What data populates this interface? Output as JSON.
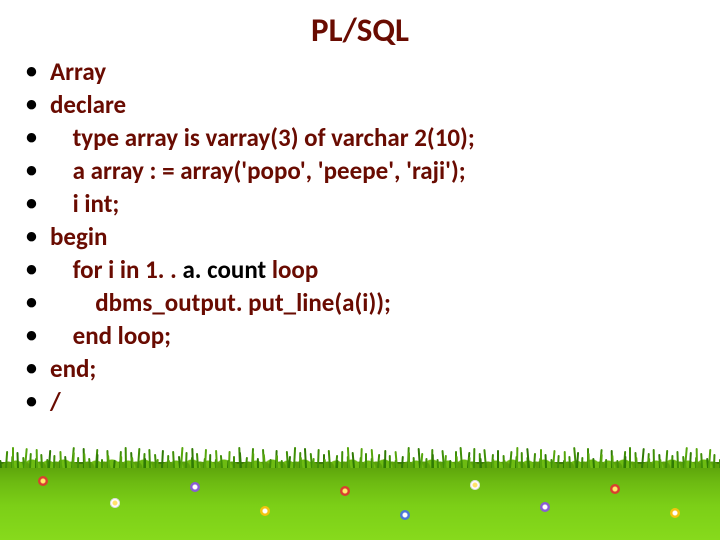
{
  "title": "PL/SQL",
  "bullets": [
    {
      "text": "Array"
    },
    {
      "text": "declare"
    },
    {
      "text": "    type array is varray(3) of varchar 2(10);"
    },
    {
      "text": "    a array : = array('popo', 'peepe', 'raji');"
    },
    {
      "text": "    i int;"
    },
    {
      "text": "begin"
    },
    {
      "text_pre": "    for i in 1. . ",
      "accent": "a. count",
      "text_post": " loop"
    },
    {
      "text": "        dbms_output. put_line(a(i));"
    },
    {
      "text": "    end loop;"
    },
    {
      "text": "end;"
    },
    {
      "text": "/"
    }
  ],
  "colors": {
    "heading": "#690b01",
    "accent_black": "#000000",
    "grass_top": "#5aa10a",
    "grass_bottom": "#87da1c"
  }
}
